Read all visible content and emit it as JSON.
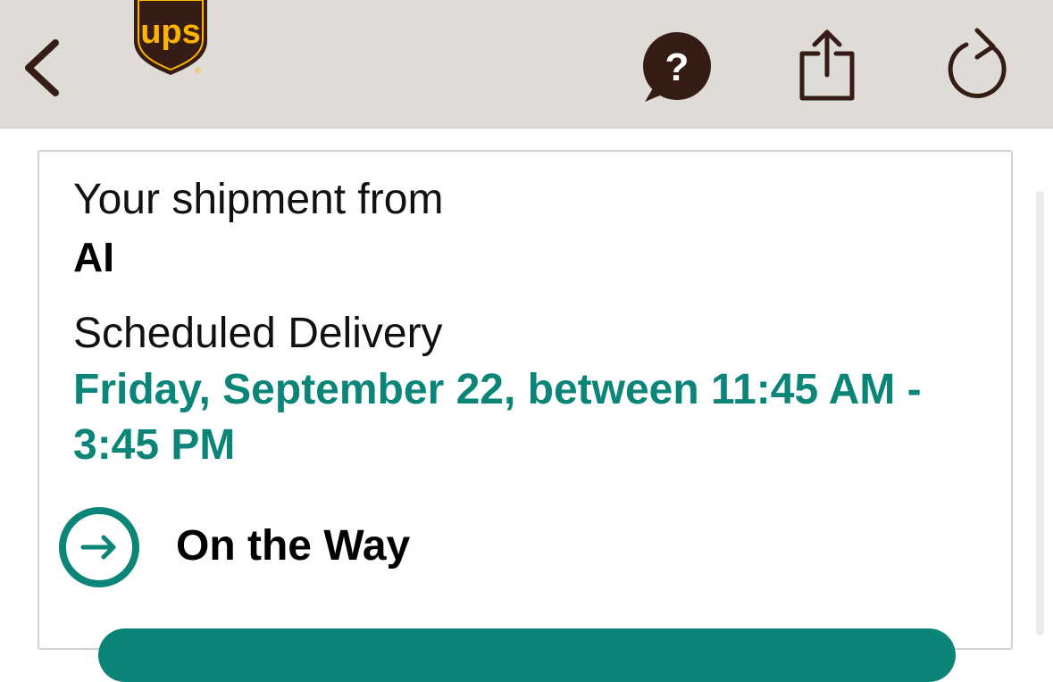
{
  "header": {
    "logo_text": "ups",
    "back_icon": "chevron-left-icon",
    "help_icon": "question-bubble-icon",
    "help_glyph": "?",
    "share_icon": "share-icon",
    "refresh_icon": "refresh-icon"
  },
  "shipment": {
    "from_label": "Your shipment from",
    "from_value": "AI",
    "scheduled_label": "Scheduled Delivery",
    "scheduled_value": "Friday, September 22, between 11:45 AM - 3:45 PM",
    "status_icon": "arrow-right-circle-icon",
    "status_text": "On the Way"
  },
  "colors": {
    "header_bg": "#dfdcd8",
    "icon_dark": "#351c15",
    "ups_brown": "#351c15",
    "ups_gold": "#ffb500",
    "accent_teal": "#0a8577"
  }
}
